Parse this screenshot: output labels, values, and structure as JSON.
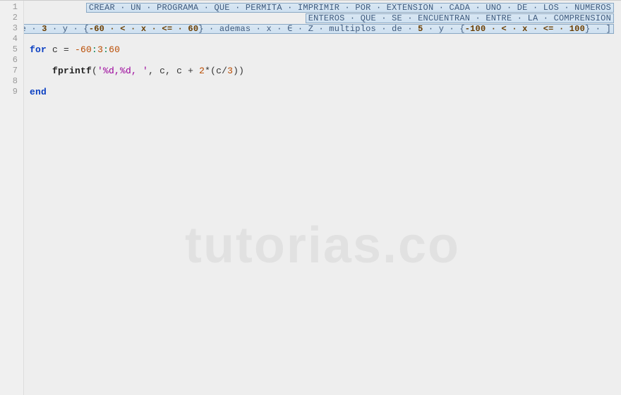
{
  "watermark": "tutorias.co",
  "gutter": [
    "1",
    "2",
    "3",
    "4",
    "5",
    "6",
    "7",
    "8",
    "9"
  ],
  "header": {
    "line1": "CREAR · UN · PROGRAMA · QUE · PERMITA · IMPRIMIR · POR · EXTENSION · CADA · UNO · DE · LOS · NUMEROS",
    "line2": "ENTEROS · QUE · SE · ENCUENTRAN · ENTRE · LA · COMPRENSION",
    "line3_a": "[ · ∀ x · / · x · ∈ · Z · multiplos · de · ",
    "line3_b": "3",
    "line3_c": " · y · {",
    "line3_d": "-60 · < · x · <= · 60",
    "line3_e": "} · ademas · x · ∈ · Z · multiplos · de · ",
    "line3_f": "5",
    "line3_g": " · y · {",
    "line3_h": "-100 · < · x · <= · 100",
    "line3_i": "} · ]"
  },
  "code": {
    "for_kw": "for",
    "for_rest_1": " c = ",
    "for_rest_2": "-60",
    "for_rest_3": ":",
    "for_rest_4": "3",
    "for_rest_5": ":",
    "for_rest_6": "60",
    "fprintf_indent": "    ",
    "fprintf_name": "fprintf",
    "fprintf_open": "(",
    "fprintf_str": "'%d,%d, '",
    "fprintf_mid1": ", c, c + ",
    "fprintf_mid2": "2",
    "fprintf_mid3": "*(c/",
    "fprintf_mid4": "3",
    "fprintf_close": "))",
    "end_kw": "end"
  }
}
